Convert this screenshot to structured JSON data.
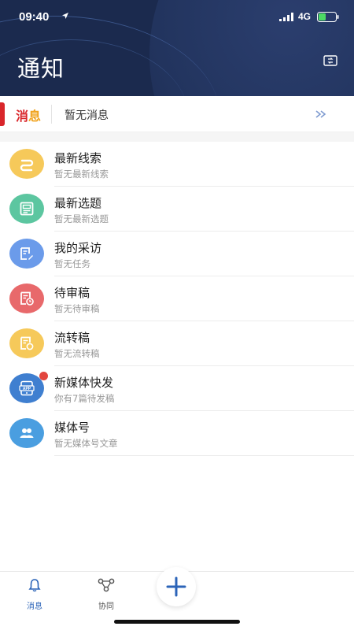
{
  "status_bar": {
    "time": "09:40",
    "network": "4G"
  },
  "header": {
    "title": "通知"
  },
  "message_bar": {
    "logo_part1": "消",
    "logo_part2": "息",
    "text": "暂无消息"
  },
  "items": [
    {
      "title": "最新线索",
      "subtitle": "暂无最新线索",
      "color": "#f6c95a",
      "icon": "link-icon"
    },
    {
      "title": "最新选题",
      "subtitle": "暂无最新选题",
      "color": "#5cc6a0",
      "icon": "newspaper-icon"
    },
    {
      "title": "我的采访",
      "subtitle": "暂无任务",
      "color": "#6b9bea",
      "icon": "interview-icon"
    },
    {
      "title": "待审稿",
      "subtitle": "暂无待审稿",
      "color": "#e8696b",
      "icon": "review-icon"
    },
    {
      "title": "流转稿",
      "subtitle": "暂无流转稿",
      "color": "#f6c95a",
      "icon": "transfer-icon"
    },
    {
      "title": "新媒体快发",
      "subtitle": "你有7篇待发稿",
      "color": "#3f7fd0",
      "icon": "app-icon",
      "badge": true
    },
    {
      "title": "媒体号",
      "subtitle": "暂无媒体号文章",
      "color": "#4a9ee0",
      "icon": "people-icon"
    }
  ],
  "tabbar": {
    "tabs": [
      {
        "label": "消息",
        "icon": "bell-icon",
        "active": true
      },
      {
        "label": "协同",
        "icon": "collab-icon",
        "active": false
      }
    ],
    "fab_icon": "plus-icon",
    "active_color": "#2c64b8"
  }
}
